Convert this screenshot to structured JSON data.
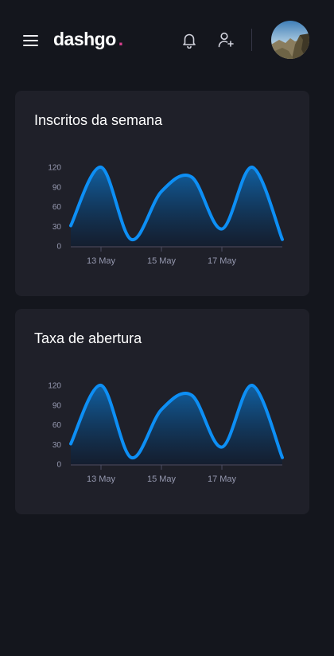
{
  "app": {
    "logo_text": "dashgo",
    "logo_dot": ".",
    "accent_color": "#d53f8c",
    "background_color": "#14161d",
    "card_color": "#1f2029"
  },
  "header": {
    "icons": [
      "menu-icon",
      "bell-icon",
      "user-add-icon"
    ]
  },
  "cards": [
    {
      "title": "Inscritos da semana"
    },
    {
      "title": "Taxa de abertura"
    }
  ],
  "chart_data": [
    {
      "type": "area",
      "title": "Inscritos da semana",
      "x": [
        "2021-05-12",
        "2021-05-13",
        "2021-05-14",
        "2021-05-15",
        "2021-05-16",
        "2021-05-17",
        "2021-05-18",
        "2021-05-19"
      ],
      "x_tick_labels": [
        "13 May",
        "15 May",
        "17 May"
      ],
      "x_tick_positions": [
        "2021-05-13",
        "2021-05-15",
        "2021-05-17"
      ],
      "values": [
        31,
        120,
        10,
        83,
        105,
        26,
        120,
        10
      ],
      "y_ticks": [
        0,
        30,
        60,
        90,
        120
      ],
      "ylim": [
        0,
        120
      ],
      "line_color": "#0d8ff5",
      "grid": false
    },
    {
      "type": "area",
      "title": "Taxa de abertura",
      "x": [
        "2021-05-12",
        "2021-05-13",
        "2021-05-14",
        "2021-05-15",
        "2021-05-16",
        "2021-05-17",
        "2021-05-18",
        "2021-05-19"
      ],
      "x_tick_labels": [
        "13 May",
        "15 May",
        "17 May"
      ],
      "x_tick_positions": [
        "2021-05-13",
        "2021-05-15",
        "2021-05-17"
      ],
      "values": [
        31,
        120,
        10,
        83,
        105,
        26,
        120,
        10
      ],
      "y_ticks": [
        0,
        30,
        60,
        90,
        120
      ],
      "ylim": [
        0,
        120
      ],
      "line_color": "#0d8ff5",
      "grid": false
    }
  ]
}
